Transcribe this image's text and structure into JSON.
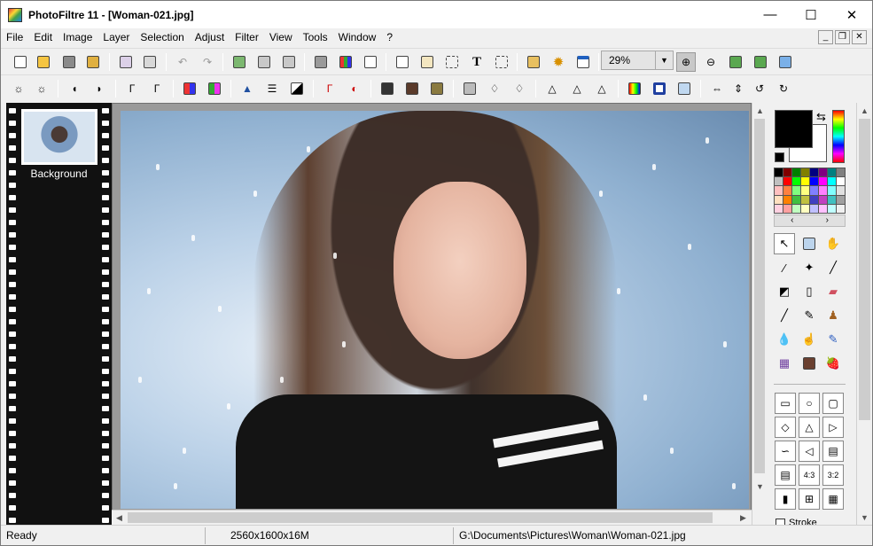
{
  "window": {
    "title": "PhotoFiltre 11 - [Woman-021.jpg]",
    "minimize": "—",
    "maximize": "☐",
    "close": "✕"
  },
  "mdi": {
    "minimize": "_",
    "restore": "❐",
    "close": "✕"
  },
  "menu": [
    "File",
    "Edit",
    "Image",
    "Layer",
    "Selection",
    "Adjust",
    "Filter",
    "View",
    "Tools",
    "Window",
    "?"
  ],
  "zoom": {
    "value": "29%"
  },
  "layers": {
    "items": [
      {
        "label": "Background"
      }
    ]
  },
  "tools": {
    "stroke_label": "Stroke"
  },
  "palette_nav": {
    "prev": "‹",
    "next": "›"
  },
  "palette": [
    "#000000",
    "#800000",
    "#008000",
    "#808000",
    "#000080",
    "#800080",
    "#008080",
    "#808080",
    "#c0c0c0",
    "#ff0000",
    "#00ff00",
    "#ffff00",
    "#0000ff",
    "#ff00ff",
    "#00ffff",
    "#ffffff",
    "#ffc0c0",
    "#ff8040",
    "#80ff80",
    "#ffff80",
    "#8080ff",
    "#ff80ff",
    "#80ffff",
    "#e0e0e0",
    "#ffe0c0",
    "#ff8000",
    "#40c040",
    "#c0c040",
    "#4040c0",
    "#c040c0",
    "#40c0c0",
    "#a0a0a0",
    "#ffd0e0",
    "#ffa0a0",
    "#c0ffc0",
    "#ffffc0",
    "#c0c0ff",
    "#ffc0ff",
    "#c0ffff",
    "#f0f0f0"
  ],
  "status": {
    "state": "Ready",
    "image_info": "2560x1600x16M",
    "file_path": "G:\\Documents\\Pictures\\Woman\\Woman-021.jpg"
  }
}
